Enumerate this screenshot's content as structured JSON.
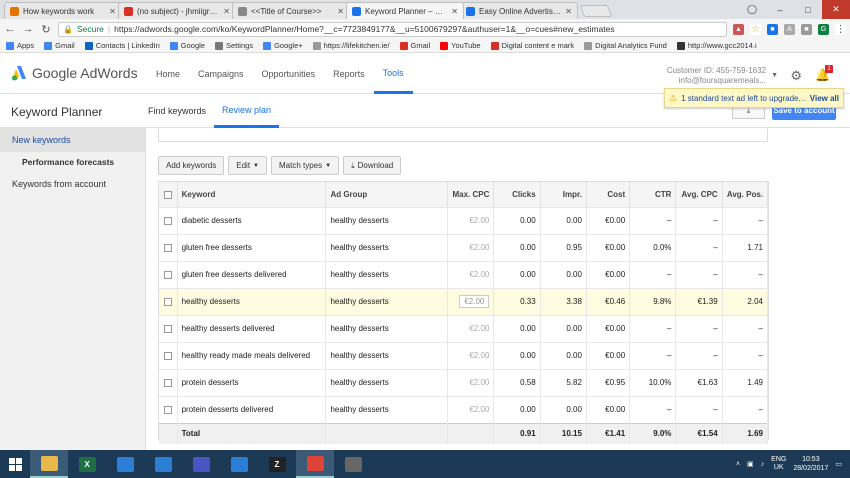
{
  "browser": {
    "tabs": [
      {
        "title": "How keywords work",
        "color": "#e37400",
        "active": false
      },
      {
        "title": "(no subject) - jhmiigrad@",
        "color": "#d93025",
        "active": false
      },
      {
        "title": "<<Title of Course>>",
        "color": "#888888",
        "active": false
      },
      {
        "title": "Keyword Planner – Goog",
        "color": "#1a73e8",
        "active": true
      },
      {
        "title": "Easy Online Advertising |",
        "color": "#1a73e8",
        "active": false
      }
    ],
    "secure_label": "Secure",
    "url": "https://adwords.google.com/ko/KeywordPlanner/Home?__c=7723849177&__u=5100679297&authuser=1&__o=cues#new_estimates",
    "bookmarks": [
      {
        "label": "Apps",
        "icon": "apps-grid-icon",
        "color": "#4285f4"
      },
      {
        "label": "Gmail",
        "icon": "google-g-icon",
        "color": "#4285f4"
      },
      {
        "label": "Contacts | LinkedIn",
        "icon": "linkedin-icon",
        "color": "#0a66c2"
      },
      {
        "label": "Google",
        "icon": "google-g-icon",
        "color": "#4285f4"
      },
      {
        "label": "Settings",
        "icon": "gear-icon",
        "color": "#777777"
      },
      {
        "label": "Google+",
        "icon": "google-g-icon",
        "color": "#4285f4"
      },
      {
        "label": "https://lifekitchen.ie/",
        "icon": "page-icon",
        "color": "#999999"
      },
      {
        "label": "Gmail",
        "icon": "gmail-icon",
        "color": "#d93025"
      },
      {
        "label": "YouTube",
        "icon": "youtube-icon",
        "color": "#ff0000"
      },
      {
        "label": "Digital content e mark",
        "icon": "page-icon",
        "color": "#d93025"
      },
      {
        "label": "Digital Analytics Fund",
        "icon": "page-icon",
        "color": "#999999"
      },
      {
        "label": "http://www.gcc2014.i",
        "icon": "page-icon",
        "color": "#333333"
      }
    ]
  },
  "header": {
    "logo_text": "Google AdWords",
    "nav": [
      {
        "label": "Home",
        "active": false
      },
      {
        "label": "Campaigns",
        "active": false
      },
      {
        "label": "Opportunities",
        "active": false
      },
      {
        "label": "Reports",
        "active": false
      },
      {
        "label": "Tools",
        "active": true
      }
    ],
    "customer_id": "Customer ID: 455-759-1632",
    "email": "info@foursquaremeals...",
    "notification_count": "1",
    "notice_text": "1 standard text ad left to upgrade...",
    "notice_link": "View all"
  },
  "subheader": {
    "title": "Keyword Planner",
    "tabs": [
      {
        "label": "Find keywords",
        "active": false
      },
      {
        "label": "Review plan",
        "active": true
      }
    ],
    "save_button": "Save to account"
  },
  "sidebar": {
    "items": [
      {
        "label": "New keywords",
        "active": true
      },
      {
        "label": "Performance forecasts",
        "sub": true
      },
      {
        "label": "Keywords from account",
        "active": false
      }
    ]
  },
  "toolbar": {
    "add_keywords": "Add keywords",
    "edit": "Edit",
    "match_types": "Match types",
    "download": "Download"
  },
  "table": {
    "headers": [
      "Keyword",
      "Ad Group",
      "Max. CPC",
      "Clicks",
      "Impr.",
      "Cost",
      "CTR",
      "Avg. CPC",
      "Avg. Pos."
    ],
    "rows": [
      {
        "keyword": "diabetic desserts",
        "group": "healthy desserts",
        "cpc": "€2.00",
        "clicks": "0.00",
        "impr": "0.00",
        "cost": "€0.00",
        "ctr": "–",
        "avgcpc": "–",
        "avgpos": "–",
        "highlight": false
      },
      {
        "keyword": "gluten free desserts",
        "group": "healthy desserts",
        "cpc": "€2.00",
        "clicks": "0.00",
        "impr": "0.95",
        "cost": "€0.00",
        "ctr": "0.0%",
        "avgcpc": "–",
        "avgpos": "1.71",
        "highlight": false
      },
      {
        "keyword": "gluten free desserts delivered",
        "group": "healthy desserts",
        "cpc": "€2.00",
        "clicks": "0.00",
        "impr": "0.00",
        "cost": "€0.00",
        "ctr": "–",
        "avgcpc": "–",
        "avgpos": "–",
        "highlight": false
      },
      {
        "keyword": "healthy desserts",
        "group": "healthy desserts",
        "cpc": "€2.00",
        "clicks": "0.33",
        "impr": "3.38",
        "cost": "€0.46",
        "ctr": "9.8%",
        "avgcpc": "€1.39",
        "avgpos": "2.04",
        "highlight": true
      },
      {
        "keyword": "healthy desserts delivered",
        "group": "healthy desserts",
        "cpc": "€2.00",
        "clicks": "0.00",
        "impr": "0.00",
        "cost": "€0.00",
        "ctr": "–",
        "avgcpc": "–",
        "avgpos": "–",
        "highlight": false
      },
      {
        "keyword": "healthy ready made meals delivered",
        "group": "healthy desserts",
        "cpc": "€2.00",
        "clicks": "0.00",
        "impr": "0.00",
        "cost": "€0.00",
        "ctr": "–",
        "avgcpc": "–",
        "avgpos": "–",
        "highlight": false
      },
      {
        "keyword": "protein desserts",
        "group": "healthy desserts",
        "cpc": "€2.00",
        "clicks": "0.58",
        "impr": "5.82",
        "cost": "€0.95",
        "ctr": "10.0%",
        "avgcpc": "€1.63",
        "avgpos": "1.49",
        "highlight": false
      },
      {
        "keyword": "protein desserts delivered",
        "group": "healthy desserts",
        "cpc": "€2.00",
        "clicks": "0.00",
        "impr": "0.00",
        "cost": "€0.00",
        "ctr": "–",
        "avgcpc": "–",
        "avgpos": "–",
        "highlight": false
      }
    ],
    "total": {
      "label": "Total",
      "clicks": "0.91",
      "impr": "10.15",
      "cost": "€1.41",
      "ctr": "9.0%",
      "avgcpc": "€1.54",
      "avgpos": "1.69"
    }
  },
  "taskbar": {
    "apps": [
      {
        "name": "file-explorer-icon",
        "glyph": "",
        "color": "#e8b84a",
        "active": true
      },
      {
        "name": "excel-icon",
        "glyph": "X",
        "color": "#1d7044",
        "active": false
      },
      {
        "name": "photos-icon",
        "glyph": "",
        "color": "#2a7fd4",
        "active": false
      },
      {
        "name": "mail-icon",
        "glyph": "",
        "color": "#2a7fd4",
        "active": false
      },
      {
        "name": "calculator-icon",
        "glyph": "",
        "color": "#4a55c4",
        "active": false
      },
      {
        "name": "weather-icon",
        "glyph": "",
        "color": "#2a7fd4",
        "active": false
      },
      {
        "name": "app-icon",
        "glyph": "Z",
        "color": "#222222",
        "active": false
      },
      {
        "name": "chrome-icon",
        "glyph": "",
        "color": "#db4437",
        "active": true
      },
      {
        "name": "document-icon",
        "glyph": "",
        "color": "#666666",
        "active": false
      }
    ],
    "lang_1": "ENG",
    "lang_2": "UK",
    "time": "10:53",
    "date": "28/02/2017"
  },
  "colors": {
    "accent": "#1a73e8",
    "save_button": "#4285f4",
    "highlight_row": "#fffbe0",
    "taskbar": "#1c3a56"
  }
}
